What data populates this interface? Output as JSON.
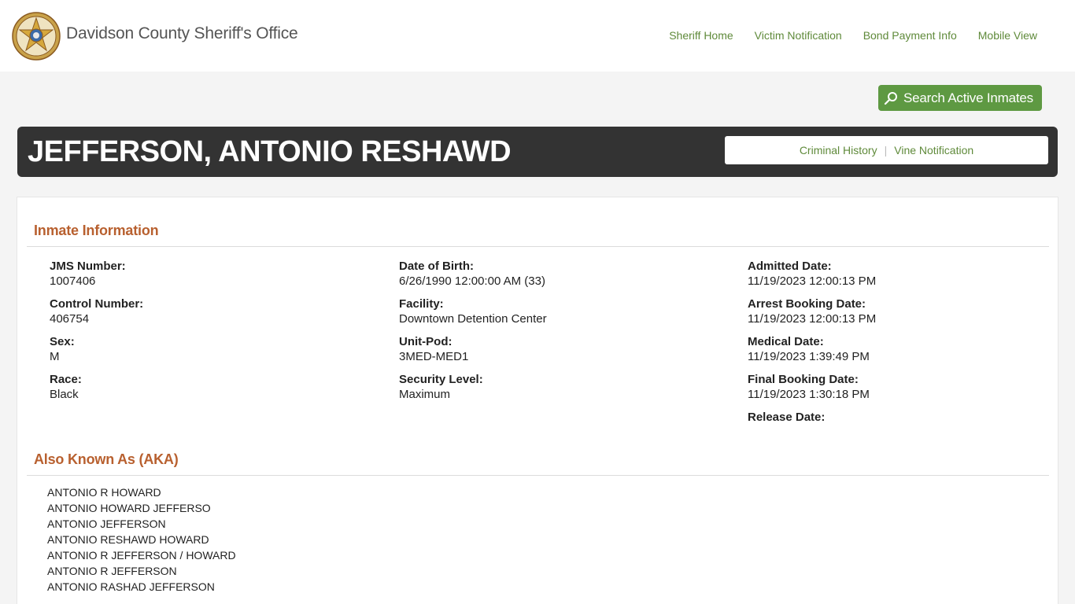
{
  "header": {
    "site_title": "Davidson County Sheriff's Office",
    "nav": [
      "Sheriff Home",
      "Victim Notification",
      "Bond Payment Info",
      "Mobile View"
    ]
  },
  "search": {
    "label": "Search Active Inmates",
    "icon": "magnifier-icon"
  },
  "inmate": {
    "name": "JEFFERSON, ANTONIO RESHAWD",
    "links": [
      "Criminal History",
      "Vine Notification"
    ],
    "link_separator": "|"
  },
  "info": {
    "title": "Inmate Information",
    "col1": [
      {
        "label": "JMS Number:",
        "value": "1007406"
      },
      {
        "label": "Control Number:",
        "value": "406754"
      },
      {
        "label": "Sex:",
        "value": "M"
      },
      {
        "label": "Race:",
        "value": "Black"
      }
    ],
    "col2": [
      {
        "label": "Date of Birth:",
        "value": "6/26/1990 12:00:00 AM (33)"
      },
      {
        "label": "Facility:",
        "value": "Downtown Detention Center"
      },
      {
        "label": "Unit-Pod:",
        "value": "3MED-MED1"
      },
      {
        "label": "Security Level:",
        "value": "Maximum"
      }
    ],
    "col3": [
      {
        "label": "Admitted Date:",
        "value": "11/19/2023 12:00:13 PM"
      },
      {
        "label": "Arrest Booking Date:",
        "value": "11/19/2023 12:00:13 PM"
      },
      {
        "label": "Medical Date:",
        "value": "11/19/2023 1:39:49 PM"
      },
      {
        "label": "Final Booking Date:",
        "value": "11/19/2023 1:30:18 PM"
      },
      {
        "label": "Release Date:",
        "value": ""
      }
    ]
  },
  "aka": {
    "title": "Also Known As (AKA)",
    "names": [
      "ANTONIO R HOWARD",
      "ANTONIO HOWARD JEFFERSO",
      "ANTONIO JEFFERSON",
      "ANTONIO RESHAWD HOWARD",
      "ANTONIO R JEFFERSON / HOWARD",
      "ANTONIO R JEFFERSON",
      "ANTONIO RASHAD JEFFERSON"
    ]
  },
  "colors": {
    "accent_green": "#5e9942",
    "link_green": "#5f8a3a",
    "section_orange": "#b8602f",
    "namebar_dark": "#333333"
  }
}
